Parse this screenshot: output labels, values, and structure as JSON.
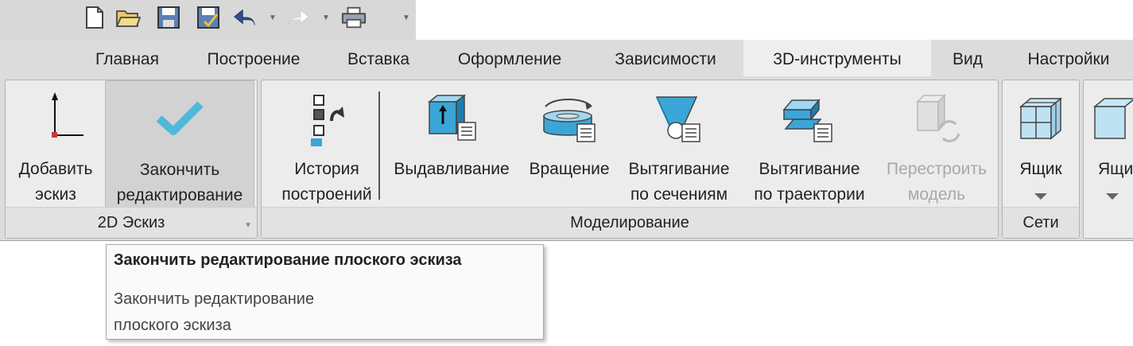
{
  "quick_access": {
    "icons": [
      "new-document-icon",
      "open-folder-icon",
      "save-icon",
      "save-as-icon",
      "undo-icon",
      "redo-icon",
      "print-icon",
      "customize-toolbar-icon"
    ]
  },
  "tabs": [
    {
      "label": "Главная",
      "active": false
    },
    {
      "label": "Построение",
      "active": false
    },
    {
      "label": "Вставка",
      "active": false
    },
    {
      "label": "Оформление",
      "active": false
    },
    {
      "label": "Зависимости",
      "active": false
    },
    {
      "label": "3D-инструменты",
      "active": true
    },
    {
      "label": "Вид",
      "active": false
    },
    {
      "label": "Настройки",
      "active": false
    }
  ],
  "groups": {
    "sketch": {
      "label": "2D Эскиз",
      "add_sketch": {
        "line1": "Добавить",
        "line2": "эскиз"
      },
      "finish_edit": {
        "line1": "Закончить",
        "line2": "редактирование"
      }
    },
    "modeling": {
      "label": "Моделирование",
      "history": {
        "line1": "История",
        "line2": "построений"
      },
      "extrude": {
        "line1": "Выдавливание"
      },
      "revolve": {
        "line1": "Вращение"
      },
      "loft": {
        "line1": "Вытягивание",
        "line2": "по сечениям"
      },
      "sweep": {
        "line1": "Вытягивание",
        "line2": "по траектории"
      },
      "rebuild": {
        "line1": "Перестроить",
        "line2": "модель",
        "disabled": true
      }
    },
    "grids": {
      "label": "Сети",
      "box": {
        "line1": "Ящик"
      }
    },
    "partial": {
      "box": {
        "line1": "Ящи"
      }
    }
  },
  "tooltip": {
    "title": "Закончить редактирование плоского эскиза",
    "desc_line1": "Закончить редактирование",
    "desc_line2": "плоского эскиза"
  },
  "colors": {
    "accent_blue": "#3aa6d8",
    "check_blue": "#4fb8dc",
    "disabled_text": "#a8a8a8"
  }
}
